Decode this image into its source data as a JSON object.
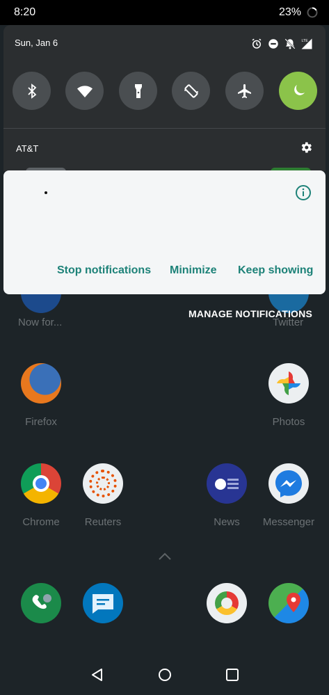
{
  "status_bar": {
    "time": "8:20",
    "battery": "23%"
  },
  "quick_settings": {
    "date": "Sun, Jan 6",
    "status_icons": [
      "alarm-icon",
      "do-not-disturb-icon",
      "notifications-off-icon",
      "signal-lte-icon"
    ],
    "tiles": [
      {
        "name": "bluetooth-icon",
        "active": false
      },
      {
        "name": "wifi-icon",
        "active": false
      },
      {
        "name": "flashlight-icon",
        "active": false
      },
      {
        "name": "auto-rotate-icon",
        "active": false
      },
      {
        "name": "airplane-mode-icon",
        "active": false
      },
      {
        "name": "night-mode-icon",
        "active": true
      }
    ],
    "carrier": "AT&T",
    "accent_color": "#8bc34a"
  },
  "dialog": {
    "actions": {
      "stop": "Stop notifications",
      "minimize": "Minimize",
      "keep": "Keep showing"
    },
    "accent_color": "#1d8278"
  },
  "manage_notifications": "MANAGE NOTIFICATIONS",
  "home": {
    "partial_apps": [
      {
        "label": "Now for...",
        "icon": "now-for-icon"
      },
      {
        "label": "Twitter",
        "icon": "twitter-icon"
      }
    ],
    "apps_row1": [
      {
        "label": "Firefox",
        "icon": "firefox-icon"
      },
      {
        "label": "Photos",
        "icon": "photos-icon"
      }
    ],
    "apps_row2": [
      {
        "label": "Chrome",
        "icon": "chrome-icon"
      },
      {
        "label": "Reuters",
        "icon": "reuters-icon"
      },
      {
        "label": "News",
        "icon": "news-icon"
      },
      {
        "label": "Messenger",
        "icon": "messenger-icon"
      }
    ],
    "dock": [
      "phone-icon",
      "messages-icon",
      "camera-icon",
      "maps-icon"
    ]
  },
  "nav": [
    "back-icon",
    "home-icon",
    "recents-icon"
  ]
}
